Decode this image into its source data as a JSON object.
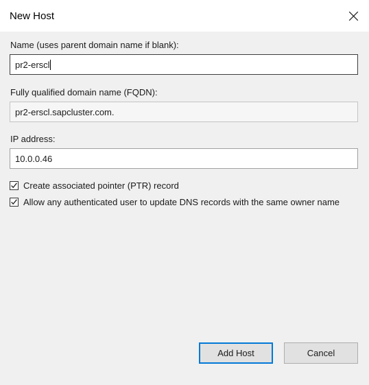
{
  "window": {
    "title": "New Host",
    "close_icon": "close-icon",
    "accent_color": "#0078d7",
    "titlebar_bg": "#ffffff",
    "body_bg": "#f0f0f0"
  },
  "form": {
    "name_field": {
      "label": "Name (uses parent domain name if blank):",
      "value": "pr2-erscl",
      "placeholder": ""
    },
    "fqdn_field": {
      "label": "Fully qualified domain name (FQDN):",
      "value": "pr2-erscl.sapcluster.com.",
      "placeholder": ""
    },
    "ip_field": {
      "label": "IP address:",
      "value": "10.0.0.46",
      "placeholder": ""
    },
    "checkboxes": [
      {
        "label": "Create associated pointer (PTR) record",
        "checked": true
      },
      {
        "label": "Allow any authenticated user to update DNS records with the same owner name",
        "checked": true
      }
    ]
  },
  "footer": {
    "add_host_label": "Add Host",
    "cancel_label": "Cancel"
  }
}
